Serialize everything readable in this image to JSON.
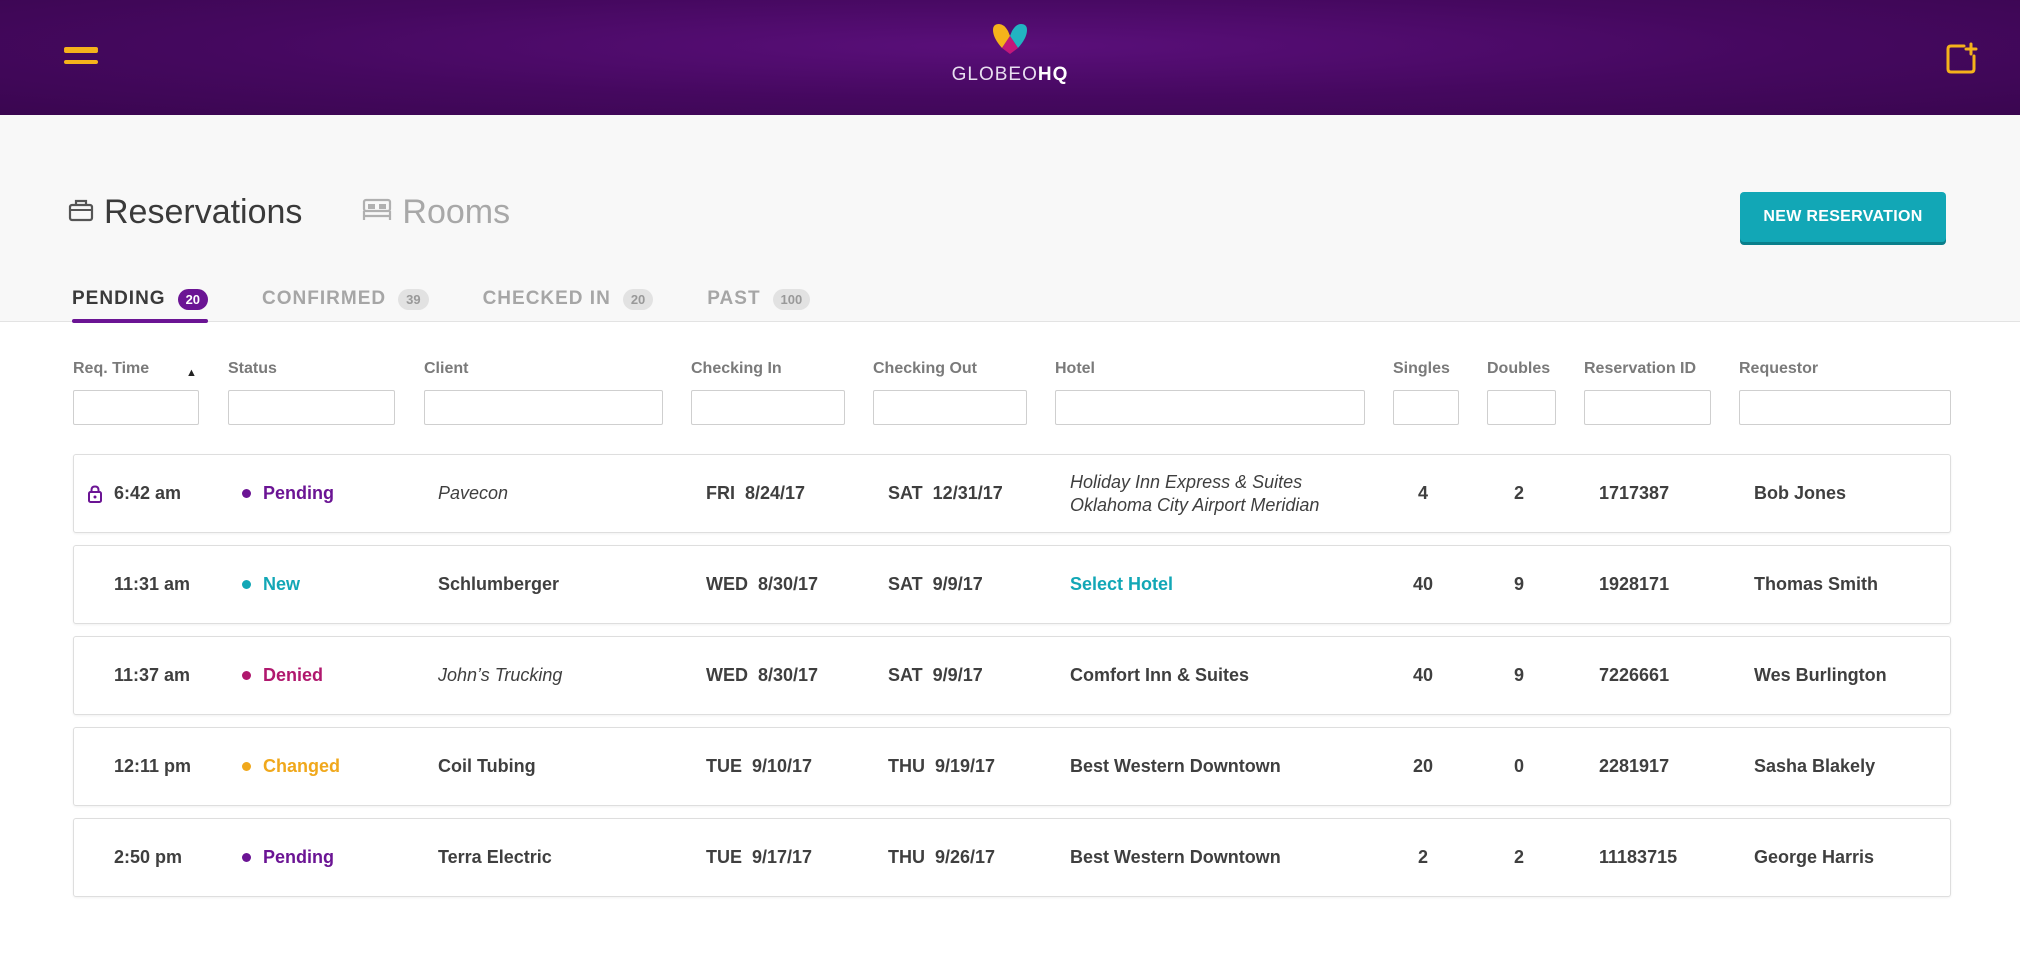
{
  "header": {
    "logo_light": "GLOBEO",
    "logo_bold": "HQ",
    "menu_icon": "hamburger-icon",
    "add_icon": "new-item-icon"
  },
  "views": [
    {
      "label": "Reservations",
      "icon": "luggage-icon",
      "active": true
    },
    {
      "label": "Rooms",
      "icon": "bed-icon",
      "active": false
    }
  ],
  "new_reservation_label": "NEW RESERVATION",
  "tabs": [
    {
      "label": "PENDING",
      "count": "20",
      "active": true
    },
    {
      "label": "CONFIRMED",
      "count": "39",
      "active": false
    },
    {
      "label": "CHECKED IN",
      "count": "20",
      "active": false
    },
    {
      "label": "PAST",
      "count": "100",
      "active": false
    }
  ],
  "columns": {
    "req_time": "Req. Time",
    "status": "Status",
    "client": "Client",
    "checking_in": "Checking In",
    "checking_out": "Checking Out",
    "hotel": "Hotel",
    "singles": "Singles",
    "doubles": "Doubles",
    "reservation_id": "Reservation ID",
    "requestor": "Requestor",
    "sort_indicator": "▲"
  },
  "colors": {
    "accent_purple": "#6b1494",
    "accent_teal": "#12a7b6",
    "pending": "#6b1494",
    "new": "#12a7b6",
    "denied": "#b0186e",
    "changed": "#f0a81c"
  },
  "rows": [
    {
      "time": "6:42 am",
      "locked": true,
      "status": "Pending",
      "status_color": "#6b1494",
      "client": "Pavecon",
      "client_italic": true,
      "in_day": "FRI",
      "in_date": "8/24/17",
      "out_day": "SAT",
      "out_date": "12/31/17",
      "hotel_line1": "Holiday Inn Express & Suites",
      "hotel_line2": "Oklahoma City Airport Meridian",
      "hotel_italic": true,
      "singles": "4",
      "doubles": "2",
      "reservation_id": "1717387",
      "requestor": "Bob Jones"
    },
    {
      "time": "11:31 am",
      "locked": false,
      "status": "New",
      "status_color": "#12a7b6",
      "client": "Schlumberger",
      "client_italic": false,
      "in_day": "WED",
      "in_date": "8/30/17",
      "out_day": "SAT",
      "out_date": "9/9/17",
      "hotel_line1": "Select Hotel",
      "hotel_line2": "",
      "hotel_link": true,
      "singles": "40",
      "doubles": "9",
      "reservation_id": "1928171",
      "requestor": "Thomas Smith"
    },
    {
      "time": "11:37 am",
      "locked": false,
      "status": "Denied",
      "status_color": "#b0186e",
      "client": "John’s Trucking",
      "client_italic": true,
      "in_day": "WED",
      "in_date": "8/30/17",
      "out_day": "SAT",
      "out_date": "9/9/17",
      "hotel_line1": "Comfort Inn & Suites",
      "hotel_line2": "",
      "singles": "40",
      "doubles": "9",
      "reservation_id": "7226661",
      "requestor": "Wes Burlington"
    },
    {
      "time": "12:11 pm",
      "locked": false,
      "status": "Changed",
      "status_color": "#f0a81c",
      "client": "Coil Tubing",
      "client_italic": false,
      "in_day": "TUE",
      "in_date": "9/10/17",
      "out_day": "THU",
      "out_date": "9/19/17",
      "hotel_line1": "Best Western Downtown",
      "hotel_line2": "",
      "singles": "20",
      "doubles": "0",
      "reservation_id": "2281917",
      "requestor": "Sasha Blakely"
    },
    {
      "time": "2:50 pm",
      "locked": false,
      "status": "Pending",
      "status_color": "#6b1494",
      "client": "Terra Electric",
      "client_italic": false,
      "in_day": "TUE",
      "in_date": "9/17/17",
      "out_day": "THU",
      "out_date": "9/26/17",
      "hotel_line1": "Best Western Downtown",
      "hotel_line2": "",
      "singles": "2",
      "doubles": "2",
      "reservation_id": "11183715",
      "requestor": "George Harris"
    }
  ]
}
